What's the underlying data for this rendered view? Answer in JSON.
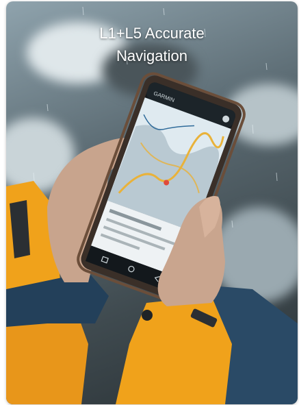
{
  "headline": {
    "line1": "L1+L5 Accurate",
    "line2": "Navigation"
  },
  "phone": {
    "app_brand": "GARMIN"
  },
  "colors": {
    "jacket": "#f0a21b",
    "sleeve_blue": "#2a4a66",
    "route": "#e9b23a",
    "map_ice": "#dfeaf0"
  },
  "icons": [
    "menu-icon",
    "home-icon",
    "back-icon"
  ]
}
